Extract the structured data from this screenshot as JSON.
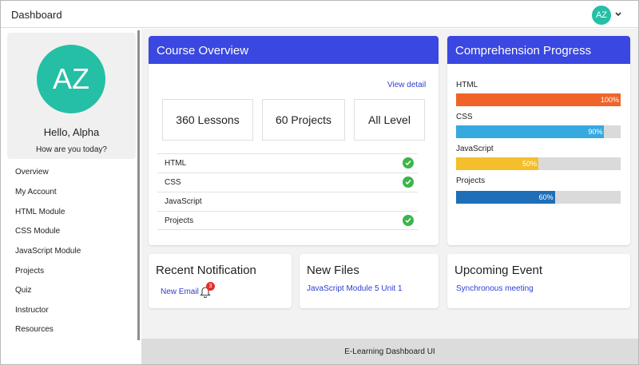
{
  "topbar": {
    "title": "Dashboard",
    "avatar_initials": "AZ"
  },
  "profile": {
    "initials": "AZ",
    "greeting": "Hello, Alpha",
    "subtitle": "How are you today?"
  },
  "nav": [
    {
      "label": "Overview"
    },
    {
      "label": "My Account"
    },
    {
      "label": "HTML Module"
    },
    {
      "label": "CSS Module"
    },
    {
      "label": "JavaScript Module"
    },
    {
      "label": "Projects"
    },
    {
      "label": "Quiz"
    },
    {
      "label": "Instructor"
    },
    {
      "label": "Resources"
    }
  ],
  "course_overview": {
    "title": "Course Overview",
    "view_detail": "View detail",
    "stats": [
      {
        "label": "360 Lessons"
      },
      {
        "label": "60 Projects"
      },
      {
        "label": "All Level"
      }
    ],
    "modules": [
      {
        "name": "HTML",
        "completed": true
      },
      {
        "name": "CSS",
        "completed": true
      },
      {
        "name": "JavaScript",
        "completed": false
      },
      {
        "name": "Projects",
        "completed": true
      }
    ]
  },
  "comprehension": {
    "title": "Comprehension Progress",
    "items": [
      {
        "name": "HTML",
        "percent": 100,
        "label": "100%",
        "color": "#f0642a"
      },
      {
        "name": "CSS",
        "percent": 90,
        "label": "90%",
        "color": "#36a9e0"
      },
      {
        "name": "JavaScript",
        "percent": 50,
        "label": "50%",
        "color": "#f4bf2a"
      },
      {
        "name": "Projects",
        "percent": 60,
        "label": "60%",
        "color": "#1e6fb8"
      }
    ]
  },
  "notifications": {
    "title": "Recent Notification",
    "link": "New Email",
    "count": "3"
  },
  "files": {
    "title": "New Files",
    "link": "JavaScript Module 5 Unit 1"
  },
  "events": {
    "title": "Upcoming Event",
    "link": "Synchronous meeting"
  },
  "footer": {
    "text": "E-Learning Dashboard UI"
  },
  "colors": {
    "accent": "#3a47e0",
    "avatar": "#25bfa6",
    "check": "#3bb54a",
    "badge": "#e52d2d"
  }
}
